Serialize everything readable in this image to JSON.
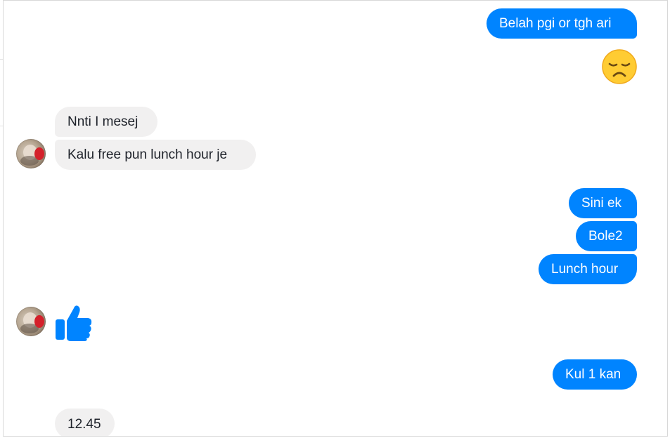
{
  "conversation": {
    "messages": [
      {
        "id": "m1",
        "direction": "outgoing",
        "text": "Belah pgi or tgh ari"
      },
      {
        "id": "m2",
        "direction": "outgoing",
        "emoji": "disappointed-face-icon"
      },
      {
        "id": "m3",
        "direction": "incoming",
        "text": "Nnti I mesej"
      },
      {
        "id": "m4",
        "direction": "incoming",
        "text": "Kalu free pun lunch hour je"
      },
      {
        "id": "m5",
        "direction": "outgoing",
        "text": "Sini ek"
      },
      {
        "id": "m6",
        "direction": "outgoing",
        "text": "Bole2"
      },
      {
        "id": "m7",
        "direction": "outgoing",
        "text": "Lunch hour"
      },
      {
        "id": "m8",
        "direction": "incoming",
        "emoji": "thumbs-up-icon"
      },
      {
        "id": "m9",
        "direction": "outgoing",
        "text": "Kul 1 kan"
      },
      {
        "id": "m10",
        "direction": "incoming",
        "text": "12.45"
      }
    ]
  },
  "theme": {
    "outgoing_color": "#0084ff",
    "incoming_color": "#f1f0f0",
    "like_color": "#0084ff"
  }
}
